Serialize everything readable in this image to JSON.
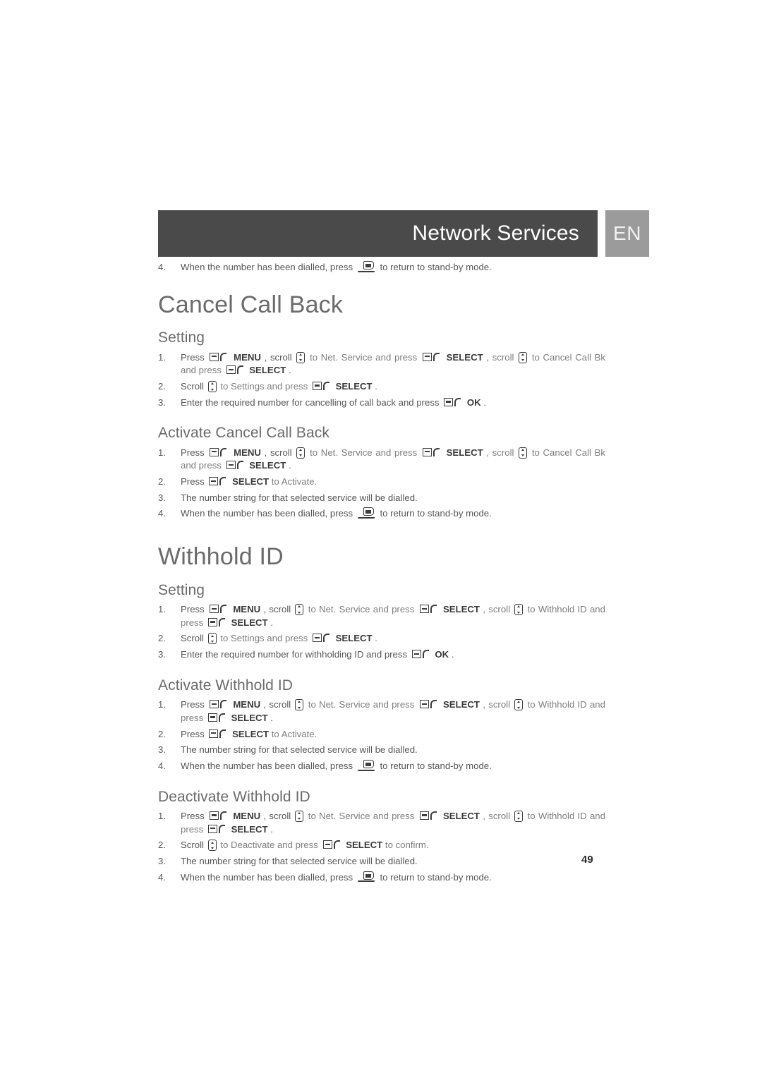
{
  "header": {
    "title": "Network Services",
    "language_badge": "EN",
    "bar_color": "#4a4a4a",
    "badge_color": "#9b9b9b"
  },
  "page_number": "49",
  "labels": {
    "press": "Press",
    "scroll": "Scroll",
    "menu": "MENU",
    "select": "SELECT",
    "ok": "OK",
    "scroll_word": "scroll",
    "press_word": "press",
    "to": "to",
    "and": "and",
    "net_service": "Net. Service",
    "cancel_call_bk": "Cancel Call Bk",
    "withhold_id": "Withhold ID",
    "settings": "Settings",
    "activate": "Activate",
    "deactivate": "Deactivate",
    "to_activate": "to Activate.",
    "to_confirm": "to confirm.",
    "comma": ",",
    "period": ".",
    "and_press": "and press"
  },
  "top_step": {
    "num": "4.",
    "text_before": "When the number has been dialled, press",
    "text_after": "to return to stand-by mode."
  },
  "sections": [
    {
      "id": "cancel-call-back",
      "title": "Cancel Call Back",
      "subsections": [
        {
          "id": "cancel-call-back-setting",
          "title": "Setting",
          "steps": [
            {
              "num": "1.",
              "parts": [
                {
                  "t": "text",
                  "v": "Press"
                },
                {
                  "t": "softkey"
                },
                {
                  "t": "bold",
                  "v": "MENU"
                },
                {
                  "t": "text",
                  "v": ", scroll"
                },
                {
                  "t": "scroll"
                },
                {
                  "t": "dim",
                  "v": "to Net. Service and press"
                },
                {
                  "t": "softkey"
                },
                {
                  "t": "bold",
                  "v": "SELECT"
                },
                {
                  "t": "dim",
                  "v": ", scroll"
                },
                {
                  "t": "scroll"
                },
                {
                  "t": "dim",
                  "v": "to Cancel Call Bk and press"
                },
                {
                  "t": "softkey"
                },
                {
                  "t": "bold",
                  "v": "SELECT"
                },
                {
                  "t": "text",
                  "v": "."
                }
              ]
            },
            {
              "num": "2.",
              "parts": [
                {
                  "t": "text",
                  "v": "Scroll"
                },
                {
                  "t": "scroll"
                },
                {
                  "t": "dim",
                  "v": "to Settings and press"
                },
                {
                  "t": "softkey"
                },
                {
                  "t": "bold",
                  "v": "SELECT"
                },
                {
                  "t": "dim",
                  "v": "."
                }
              ]
            },
            {
              "num": "3.",
              "parts": [
                {
                  "t": "text",
                  "v": "Enter the required number for cancelling of call back and press"
                },
                {
                  "t": "softkey"
                },
                {
                  "t": "bold",
                  "v": "OK"
                },
                {
                  "t": "text",
                  "v": "."
                }
              ]
            }
          ]
        },
        {
          "id": "activate-cancel-call-back",
          "title": "Activate Cancel Call Back",
          "steps": [
            {
              "num": "1.",
              "parts": [
                {
                  "t": "text",
                  "v": "Press"
                },
                {
                  "t": "softkey"
                },
                {
                  "t": "bold",
                  "v": "MENU"
                },
                {
                  "t": "text",
                  "v": ", scroll"
                },
                {
                  "t": "scroll"
                },
                {
                  "t": "dim",
                  "v": "to Net. Service and press"
                },
                {
                  "t": "softkey"
                },
                {
                  "t": "bold",
                  "v": "SELECT"
                },
                {
                  "t": "dim",
                  "v": ", scroll"
                },
                {
                  "t": "scroll"
                },
                {
                  "t": "dim",
                  "v": "to Cancel Call Bk and press"
                },
                {
                  "t": "softkey"
                },
                {
                  "t": "bold",
                  "v": "SELECT"
                },
                {
                  "t": "text",
                  "v": "."
                }
              ]
            },
            {
              "num": "2.",
              "parts": [
                {
                  "t": "text",
                  "v": "Press"
                },
                {
                  "t": "softkey"
                },
                {
                  "t": "bold",
                  "v": "SELECT"
                },
                {
                  "t": "dim",
                  "v": "to Activate."
                }
              ]
            },
            {
              "num": "3.",
              "parts": [
                {
                  "t": "text",
                  "v": "The number string for that selected service will be dialled."
                }
              ]
            },
            {
              "num": "4.",
              "parts": [
                {
                  "t": "text",
                  "v": "When the number has been dialled, press"
                },
                {
                  "t": "hangup"
                },
                {
                  "t": "text",
                  "v": "to return to stand-by mode."
                }
              ]
            }
          ]
        }
      ]
    },
    {
      "id": "withhold-id",
      "title": "Withhold ID",
      "subsections": [
        {
          "id": "withhold-id-setting",
          "title": "Setting",
          "steps": [
            {
              "num": "1.",
              "parts": [
                {
                  "t": "text",
                  "v": "Press"
                },
                {
                  "t": "softkey"
                },
                {
                  "t": "bold",
                  "v": "MENU"
                },
                {
                  "t": "text",
                  "v": ", scroll"
                },
                {
                  "t": "scroll"
                },
                {
                  "t": "dim",
                  "v": "to Net. Service and press"
                },
                {
                  "t": "softkey"
                },
                {
                  "t": "bold",
                  "v": "SELECT"
                },
                {
                  "t": "dim",
                  "v": ", scroll"
                },
                {
                  "t": "scroll"
                },
                {
                  "t": "dim",
                  "v": "to Withhold ID and press"
                },
                {
                  "t": "softkey"
                },
                {
                  "t": "bold",
                  "v": "SELECT"
                },
                {
                  "t": "text",
                  "v": "."
                }
              ]
            },
            {
              "num": "2.",
              "parts": [
                {
                  "t": "text",
                  "v": "Scroll"
                },
                {
                  "t": "scroll"
                },
                {
                  "t": "dim",
                  "v": "to Settings and press"
                },
                {
                  "t": "softkey"
                },
                {
                  "t": "bold",
                  "v": "SELECT"
                },
                {
                  "t": "dim",
                  "v": "."
                }
              ]
            },
            {
              "num": "3.",
              "parts": [
                {
                  "t": "text",
                  "v": "Enter the required number for withholding ID and press"
                },
                {
                  "t": "softkey"
                },
                {
                  "t": "bold",
                  "v": "OK"
                },
                {
                  "t": "text",
                  "v": "."
                }
              ]
            }
          ]
        },
        {
          "id": "activate-withhold-id",
          "title": "Activate Withhold ID",
          "steps": [
            {
              "num": "1.",
              "parts": [
                {
                  "t": "text",
                  "v": "Press"
                },
                {
                  "t": "softkey"
                },
                {
                  "t": "bold",
                  "v": "MENU"
                },
                {
                  "t": "text",
                  "v": ", scroll"
                },
                {
                  "t": "scroll"
                },
                {
                  "t": "dim",
                  "v": "to Net. Service and press"
                },
                {
                  "t": "softkey"
                },
                {
                  "t": "bold",
                  "v": "SELECT"
                },
                {
                  "t": "dim",
                  "v": ", scroll"
                },
                {
                  "t": "scroll"
                },
                {
                  "t": "dim",
                  "v": "to Withhold ID and press"
                },
                {
                  "t": "softkey"
                },
                {
                  "t": "bold",
                  "v": "SELECT"
                },
                {
                  "t": "text",
                  "v": "."
                }
              ]
            },
            {
              "num": "2.",
              "parts": [
                {
                  "t": "text",
                  "v": "Press"
                },
                {
                  "t": "softkey"
                },
                {
                  "t": "bold",
                  "v": "SELECT"
                },
                {
                  "t": "dim",
                  "v": "to Activate."
                }
              ]
            },
            {
              "num": "3.",
              "parts": [
                {
                  "t": "text",
                  "v": "The number string for that selected service will be dialled."
                }
              ]
            },
            {
              "num": "4.",
              "parts": [
                {
                  "t": "text",
                  "v": "When the number has been dialled, press"
                },
                {
                  "t": "hangup"
                },
                {
                  "t": "text",
                  "v": "to return to stand-by mode."
                }
              ]
            }
          ]
        },
        {
          "id": "deactivate-withhold-id",
          "title": "Deactivate Withhold ID",
          "steps": [
            {
              "num": "1.",
              "parts": [
                {
                  "t": "text",
                  "v": "Press"
                },
                {
                  "t": "softkey"
                },
                {
                  "t": "bold",
                  "v": "MENU"
                },
                {
                  "t": "text",
                  "v": ", scroll"
                },
                {
                  "t": "scroll"
                },
                {
                  "t": "dim",
                  "v": "to Net. Service and press"
                },
                {
                  "t": "softkey"
                },
                {
                  "t": "bold",
                  "v": "SELECT"
                },
                {
                  "t": "dim",
                  "v": ", scroll"
                },
                {
                  "t": "scroll"
                },
                {
                  "t": "dim",
                  "v": "to Withhold ID and press"
                },
                {
                  "t": "softkey"
                },
                {
                  "t": "bold",
                  "v": "SELECT"
                },
                {
                  "t": "text",
                  "v": "."
                }
              ]
            },
            {
              "num": "2.",
              "parts": [
                {
                  "t": "text",
                  "v": "Scroll"
                },
                {
                  "t": "scroll"
                },
                {
                  "t": "dim",
                  "v": "to Deactivate and press"
                },
                {
                  "t": "softkey"
                },
                {
                  "t": "bold",
                  "v": "SELECT"
                },
                {
                  "t": "dim",
                  "v": "to confirm."
                }
              ]
            },
            {
              "num": "3.",
              "parts": [
                {
                  "t": "text",
                  "v": "The number string for that selected service will be dialled."
                }
              ]
            },
            {
              "num": "4.",
              "parts": [
                {
                  "t": "text",
                  "v": "When the number has been dialled, press"
                },
                {
                  "t": "hangup"
                },
                {
                  "t": "text",
                  "v": "to return to stand-by mode."
                }
              ]
            }
          ]
        }
      ]
    }
  ]
}
